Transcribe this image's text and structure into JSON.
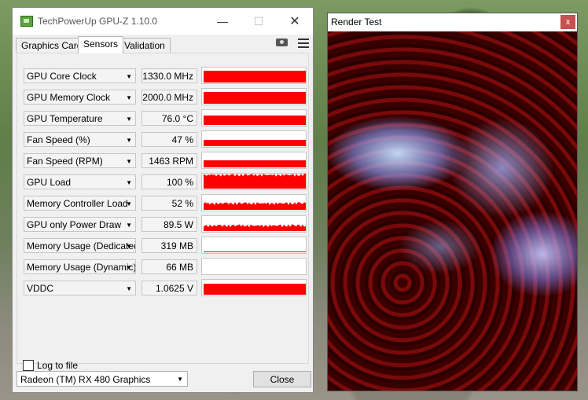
{
  "gpuz": {
    "title": "TechPowerUp GPU-Z 1.10.0",
    "tabs": [
      "Graphics Card",
      "Sensors",
      "Validation"
    ],
    "sensors": [
      {
        "name": "GPU Core Clock",
        "value": "1330.0 MHz",
        "fill": 0.8
      },
      {
        "name": "GPU Memory Clock",
        "value": "2000.0 MHz",
        "fill": 0.8
      },
      {
        "name": "GPU Temperature",
        "value": "76.0 °C",
        "fill": 0.65
      },
      {
        "name": "Fan Speed (%)",
        "value": "47 %",
        "fill": 0.4
      },
      {
        "name": "Fan Speed (RPM)",
        "value": "1463 RPM",
        "fill": 0.45
      },
      {
        "name": "GPU Load",
        "value": "100 %",
        "fill": 1.0
      },
      {
        "name": "Memory Controller Load",
        "value": "52 %",
        "fill": 0.52
      },
      {
        "name": "GPU only Power Draw",
        "value": "89.5 W",
        "fill": 0.45
      },
      {
        "name": "Memory Usage (Dedicated)",
        "value": "319 MB",
        "fill": 0.05
      },
      {
        "name": "Memory Usage (Dynamic)",
        "value": "66 MB",
        "fill": 0.0
      },
      {
        "name": "VDDC",
        "value": "1.0625 V",
        "fill": 0.75
      }
    ],
    "log_label": "Log to file",
    "gpu_name": "Radeon (TM) RX 480 Graphics",
    "close_label": "Close"
  },
  "render": {
    "title": "Render Test",
    "close_glyph": "x"
  },
  "colors": {
    "graph_fill": "#ff0000"
  }
}
